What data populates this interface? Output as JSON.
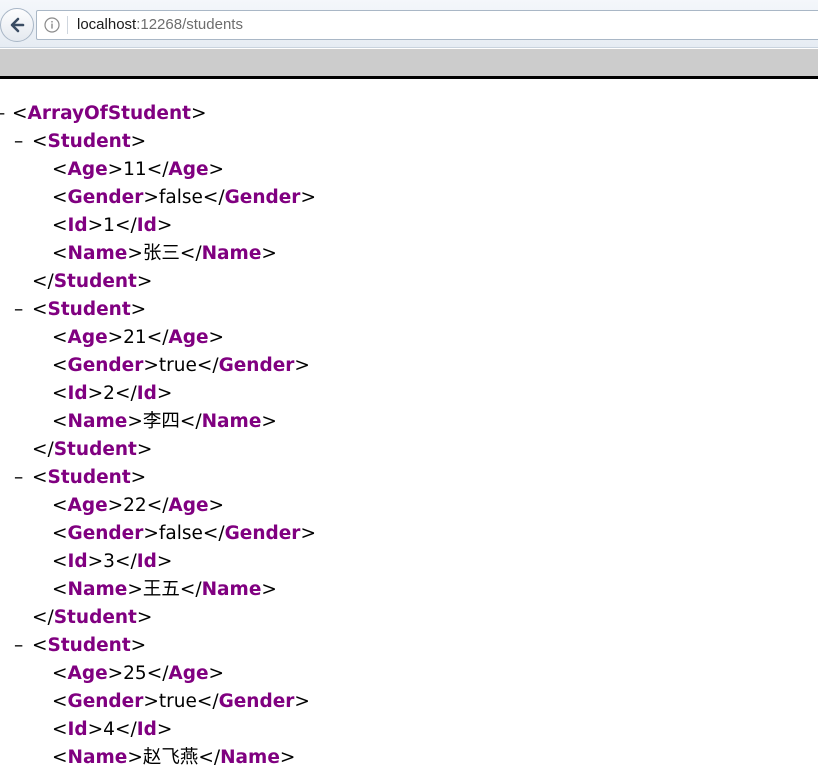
{
  "browser": {
    "url_host": "localhost",
    "url_rest": ":12268/students",
    "icons": {
      "back": "back-arrow-icon",
      "info": "info-icon"
    }
  },
  "xml": {
    "collapse_symbol": "–",
    "lt": "<",
    "lt_slash": "</",
    "gt": ">",
    "root_tag": "ArrayOfStudent",
    "item_tag": "Student",
    "students": [
      {
        "fields": [
          {
            "tag": "Age",
            "value": "11"
          },
          {
            "tag": "Gender",
            "value": "false"
          },
          {
            "tag": "Id",
            "value": "1"
          },
          {
            "tag": "Name",
            "value": "张三"
          }
        ]
      },
      {
        "fields": [
          {
            "tag": "Age",
            "value": "21"
          },
          {
            "tag": "Gender",
            "value": "true"
          },
          {
            "tag": "Id",
            "value": "2"
          },
          {
            "tag": "Name",
            "value": "李四"
          }
        ]
      },
      {
        "fields": [
          {
            "tag": "Age",
            "value": "22"
          },
          {
            "tag": "Gender",
            "value": "false"
          },
          {
            "tag": "Id",
            "value": "3"
          },
          {
            "tag": "Name",
            "value": "王五"
          }
        ]
      },
      {
        "fields": [
          {
            "tag": "Age",
            "value": "25"
          },
          {
            "tag": "Gender",
            "value": "true"
          },
          {
            "tag": "Id",
            "value": "4"
          },
          {
            "tag": "Name",
            "value": "赵飞燕"
          }
        ]
      }
    ]
  },
  "colors": {
    "tag": "#800080",
    "text": "#000000",
    "strip": "#cccccc"
  }
}
